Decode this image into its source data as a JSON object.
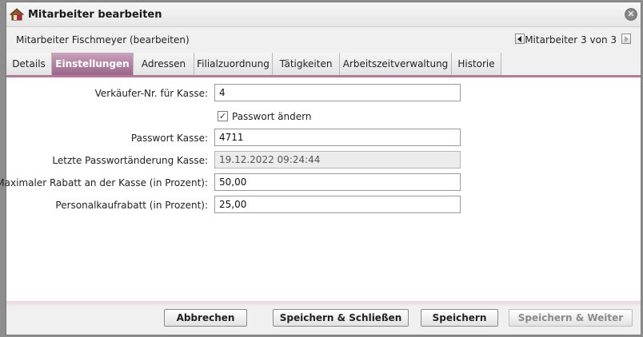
{
  "window": {
    "title": "Mitarbeiter bearbeiten",
    "icon": "house-user-icon",
    "close_glyph": "✕"
  },
  "record": {
    "title": "Mitarbeiter Fischmeyer (bearbeiten)",
    "navigation": "Mitarbeiter 3 von 3"
  },
  "tabs": [
    {
      "label": "Details",
      "active": false
    },
    {
      "label": "Einstellungen",
      "active": true
    },
    {
      "label": "Adressen",
      "active": false
    },
    {
      "label": "Filialzuordnung",
      "active": false
    },
    {
      "label": "Tätigkeiten",
      "active": false
    },
    {
      "label": "Arbeitszeitverwaltung",
      "active": false
    },
    {
      "label": "Historie",
      "active": false
    }
  ],
  "form": {
    "cashier_number": {
      "label": "Verkäufer-Nr. für Kasse:",
      "value": "4"
    },
    "change_password": {
      "label": "Passwort ändern",
      "checked": true,
      "check_glyph": "✓"
    },
    "cashier_password": {
      "label": "Passwort Kasse:",
      "value": "4711"
    },
    "last_password_change": {
      "label": "Letzte Passwortänderung Kasse:",
      "value": "19.12.2022 09:24:44"
    },
    "max_discount": {
      "label": "Maximaler Rabatt an der Kasse (in Prozent):",
      "value": "50,00"
    },
    "staff_discount": {
      "label": "Personalkaufrabatt (in Prozent):",
      "value": "25,00"
    }
  },
  "buttons": {
    "cancel": "Abbrechen",
    "save_close": "Speichern & Schließen",
    "save": "Speichern",
    "save_next": "Speichern & Weiter"
  },
  "colors": {
    "accent": "#9c6589",
    "accent_light": "#c9a3bd"
  }
}
